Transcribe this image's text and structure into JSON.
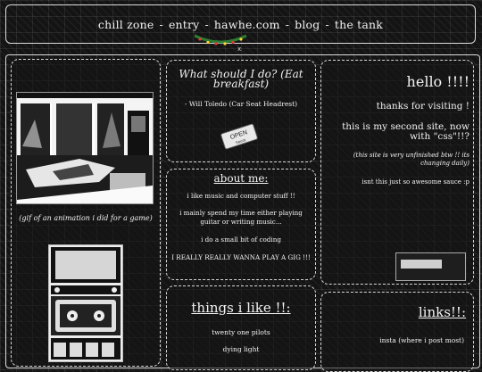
{
  "nav": {
    "items": [
      "chill zone",
      "entry",
      "hawhe.com",
      "blog",
      "the tank"
    ],
    "separator": "-",
    "close_label": "x"
  },
  "left": {
    "caption": "(gif of an animation i did for a game)"
  },
  "quote": {
    "title": "What should I do? (Eat breakfast)",
    "attribution": "- Will Toledo (Car Seat Headrest)",
    "sign_top": "OPEN",
    "sign_bottom": "hours"
  },
  "about": {
    "title": "about me:",
    "lines": [
      "i like music and computer stuff !!",
      "i mainly spend my time either playing guitar or writing music...",
      "i do a small bit of coding",
      "I REALLY REALLY WANNA PLAY A GIG !!!"
    ]
  },
  "things": {
    "title": "things i like !!:",
    "items": [
      "twenty one pilots",
      "dying light"
    ]
  },
  "hello": {
    "title": "hello !!!!",
    "thanks": "thanks for visiting !",
    "second": "this is my second site, now with \"css\"!!?",
    "note": "(this site is very unfinished btw !! its changing daily)",
    "sauce": "isnt this just so awesome sauce :p"
  },
  "links": {
    "title": "links!!:",
    "items": [
      "insta (where i post most)"
    ]
  }
}
